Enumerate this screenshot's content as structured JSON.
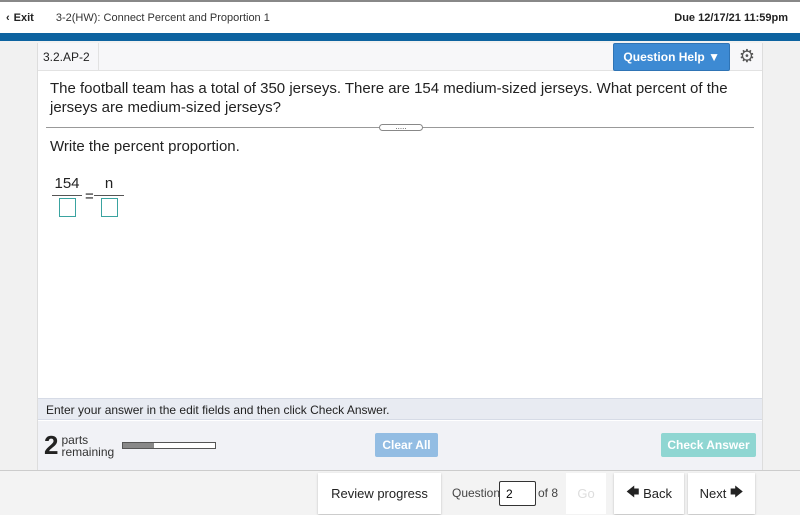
{
  "topbar": {
    "exit": "Exit",
    "title": "3-2(HW): Connect Percent and Proportion 1",
    "due": "Due 12/17/21 11:59pm"
  },
  "question": {
    "id": "3.2.AP-2",
    "help": "Question Help",
    "text": "The football team has a total of 350 jerseys. There are 154 medium-sized jerseys. What percent of the jerseys are medium-sized jerseys?",
    "instruction": "Write the percent proportion.",
    "left_numerator": "154",
    "right_numerator": "n",
    "equals": "=",
    "left_denominator": "",
    "right_denominator": ""
  },
  "footer": {
    "message": "Enter your answer in the edit fields and then click Check Answer.",
    "parts_count": "2",
    "parts_label1": "parts",
    "parts_label2": "remaining",
    "progress_percent": 33,
    "clear": "Clear All",
    "check": "Check Answer"
  },
  "nav": {
    "review": "Review progress",
    "question_label": "Question",
    "question_value": "2",
    "of": "of 8",
    "go": "Go",
    "back": "Back",
    "next": "Next"
  },
  "colors": {
    "brand_bar": "#0d63a0",
    "help_button": "#3d8ad3",
    "check_answer": "#8fd6d2",
    "clear_all": "#93bde3"
  }
}
